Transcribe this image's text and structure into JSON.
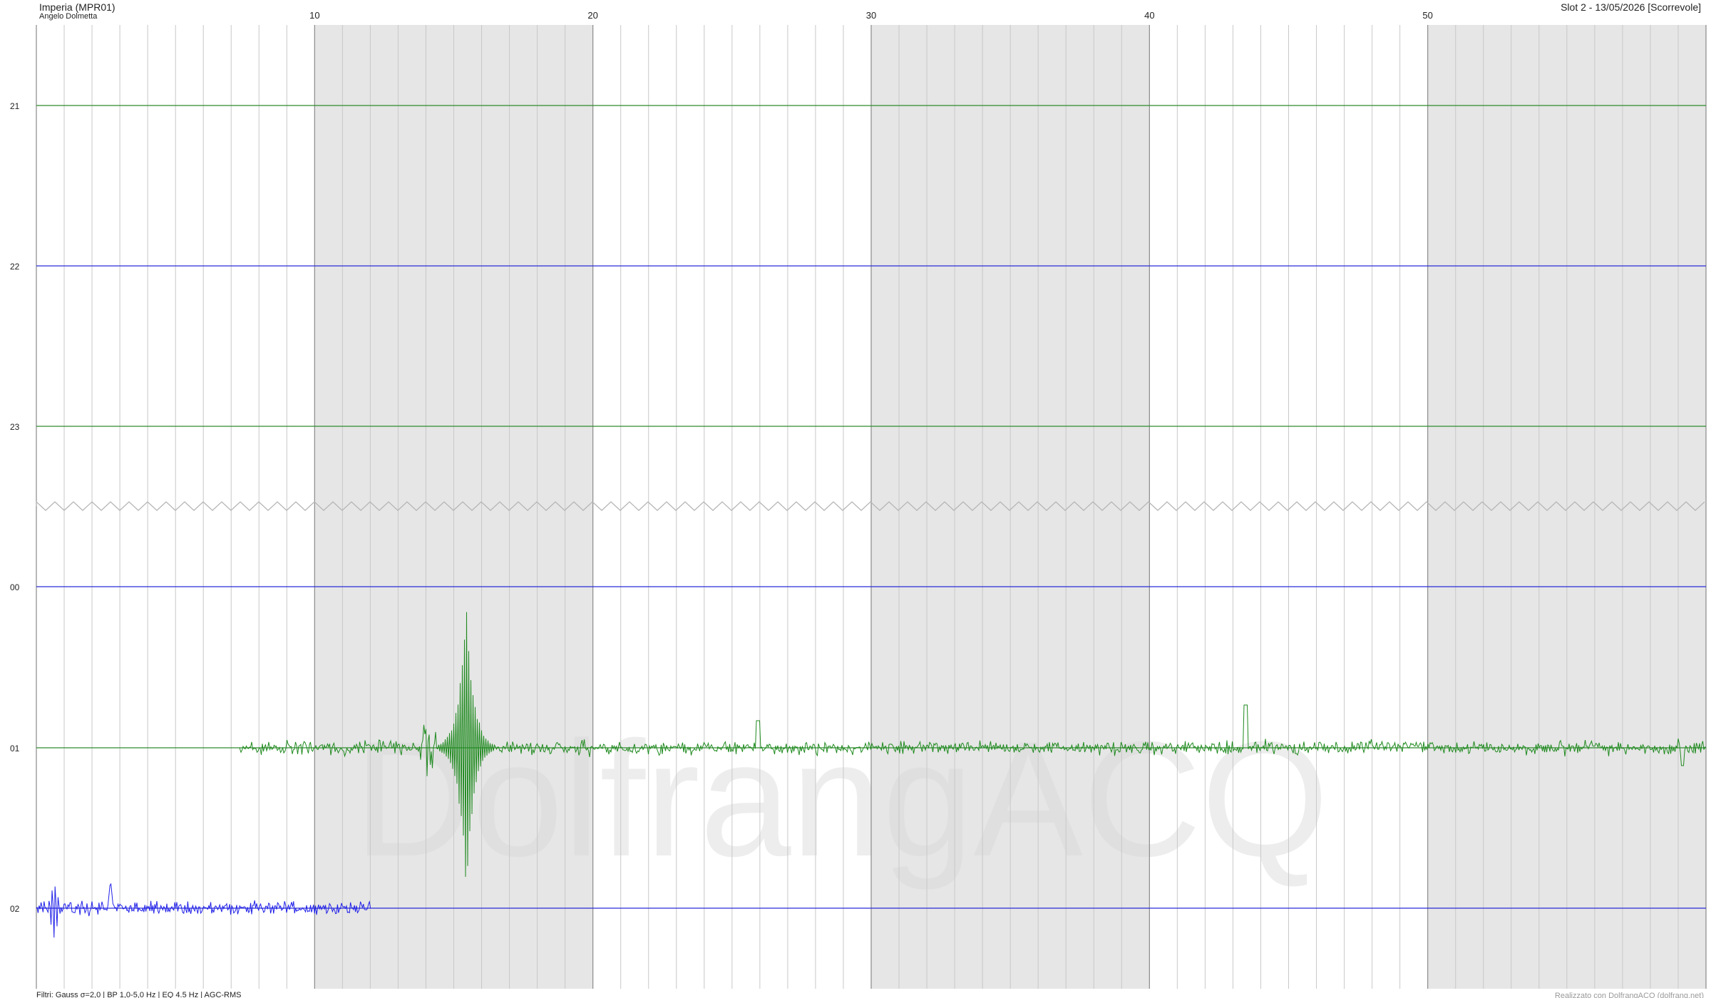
{
  "header": {
    "station_title": "Imperia (MPR01)",
    "operator": "Angelo Dolmetta",
    "slot_info": "Slot 2 - 13/05/2026 [Scorrevole]"
  },
  "footer": {
    "filters": "Filtri: Gauss σ=2,0 | BP 1,0-5,0 Hz | EQ 4.5 Hz | AGC-RMS",
    "credit": "Realizzato con DolfrangACQ (dolfrang.net)"
  },
  "watermark": "DolfrangACQ",
  "x_axis": {
    "min": 0,
    "max": 60,
    "minor_step": 1,
    "tick_labels": [
      "10",
      "20",
      "30",
      "40",
      "50"
    ]
  },
  "rows": [
    {
      "label": "21",
      "color": "#2e8b2e"
    },
    {
      "label": "22",
      "color": "#2b2bd9"
    },
    {
      "label": "23",
      "color": "#2e8b2e"
    },
    {
      "label": "00",
      "color": "#2b2bd9"
    },
    {
      "label": "01",
      "color": "#2e8b2e"
    },
    {
      "label": "02",
      "color": "#2b2bd9"
    }
  ],
  "colors": {
    "green_trace": "#1f8a1f",
    "blue_trace": "#2020e8",
    "shaded_band": "#e6e6e6",
    "grid_line": "#c8c8c8"
  }
}
